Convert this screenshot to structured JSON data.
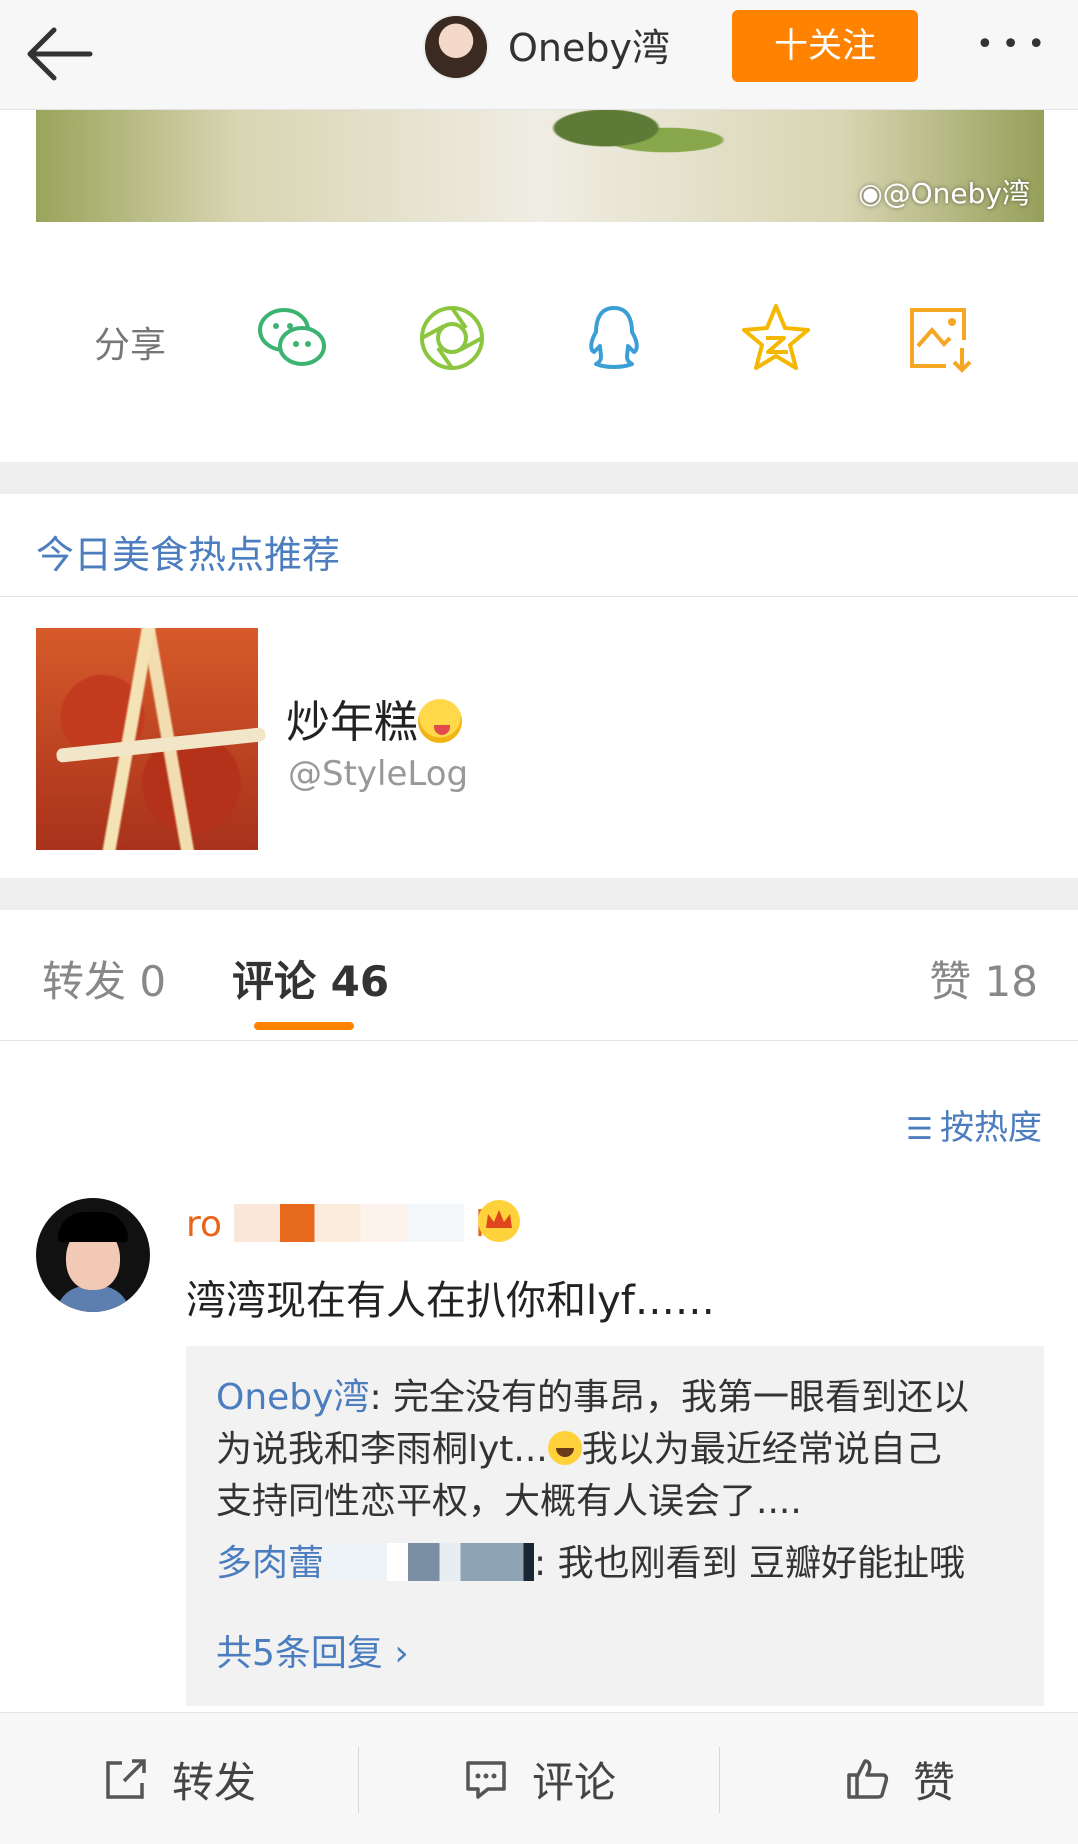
{
  "nav": {
    "username": "Oneby湾",
    "follow_label": "十关注",
    "more_label": "•••"
  },
  "post": {
    "watermark": "@Oneby湾"
  },
  "share": {
    "label": "分享",
    "icons": [
      "wechat-icon",
      "moments-icon",
      "qq-icon",
      "qzone-icon",
      "save-image-icon"
    ]
  },
  "recommendation": {
    "section_title": "今日美食热点推荐",
    "item_title": "炒年糕",
    "item_source": "@StyleLog"
  },
  "tabs": {
    "repost": "转发 0",
    "comment": "评论 46",
    "like": "赞 18"
  },
  "sort": {
    "label": "按热度"
  },
  "comment": {
    "username_start": "ro",
    "username_end": "l",
    "text": "湾湾现在有人在扒你和lyf……",
    "replies": {
      "reply1_name": "Oneby湾",
      "reply1_line1": ": 完全没有的事昂，我第一眼看到还以",
      "reply1_line2a": "为说我和李雨桐lyt...",
      "reply1_line2b": "我以为最近经常说自己",
      "reply1_line3": "支持同性恋平权，大概有人误会了....",
      "reply2_name": "多肉蕾",
      "reply2_text": ": 我也刚看到 豆瓣好能扯哦",
      "more_label": "共5条回复 ›"
    }
  },
  "bottom_bar": {
    "repost_label": "转发",
    "comment_label": "评论",
    "like_label": "赞"
  },
  "colors": {
    "accent_orange": "#ff8200",
    "link_blue": "#4b7dbf",
    "username_orange": "#e8641b"
  }
}
